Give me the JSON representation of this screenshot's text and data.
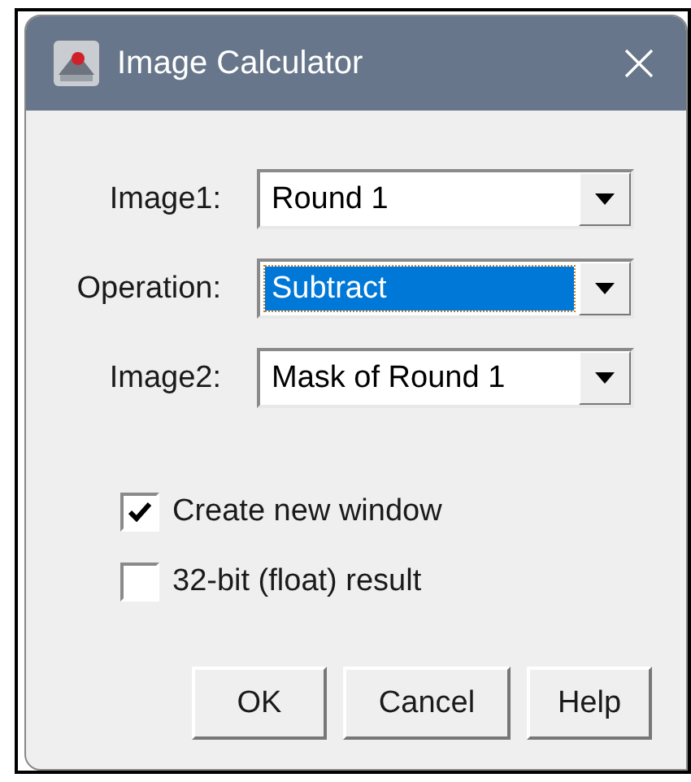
{
  "window": {
    "title": "Image Calculator"
  },
  "fields": [
    {
      "label": "Image1:",
      "value": "Round 1",
      "focused": false
    },
    {
      "label": "Operation:",
      "value": "Subtract",
      "focused": true
    },
    {
      "label": "Image2:",
      "value": "Mask of Round 1",
      "focused": false
    }
  ],
  "checkboxes": [
    {
      "label": "Create new window",
      "checked": true
    },
    {
      "label": "32-bit (float) result",
      "checked": false
    }
  ],
  "buttons": [
    "OK",
    "Cancel",
    "Help"
  ]
}
